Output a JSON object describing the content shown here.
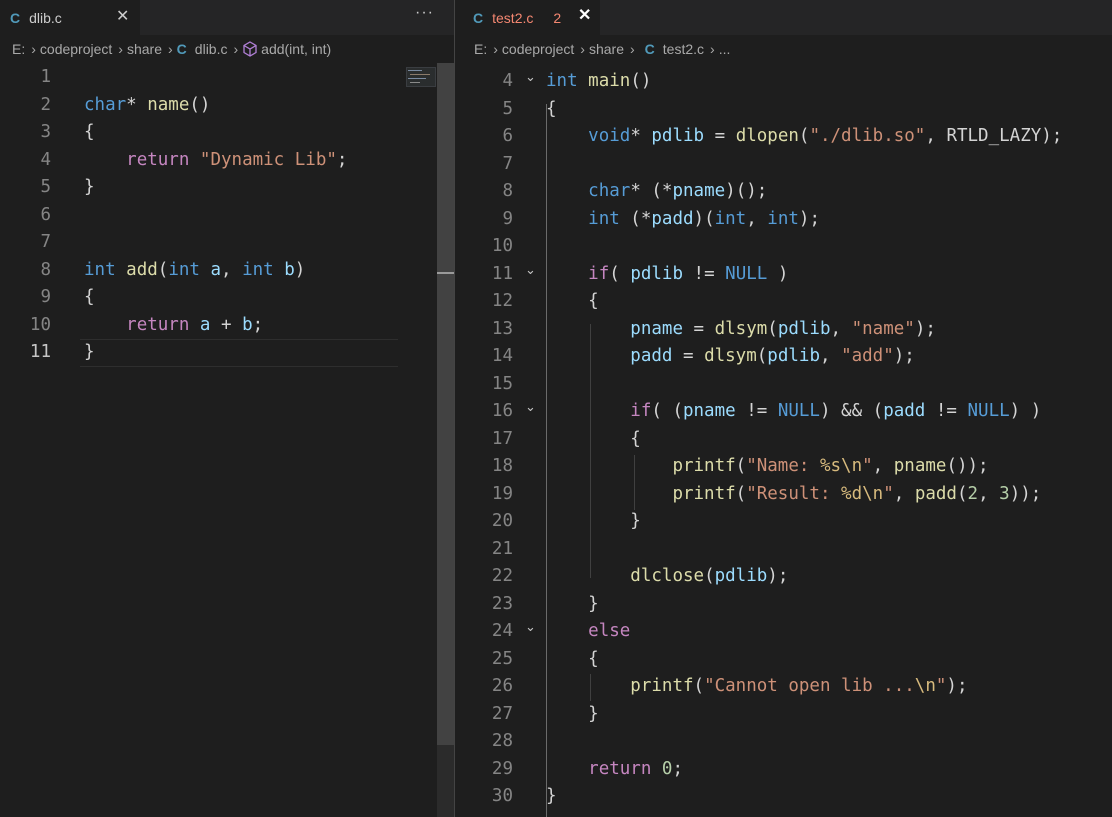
{
  "left": {
    "tab": {
      "lang": "C",
      "name": "dlib.c",
      "close": "✕"
    },
    "more": "···",
    "breadcrumb": [
      "E:",
      "codeproject",
      "share",
      "C",
      "dlib.c",
      "add(int, int)"
    ]
  },
  "right": {
    "tab": {
      "lang": "C",
      "name": "test2.c",
      "problems": "2",
      "close": "✕"
    },
    "breadcrumb": [
      "E:",
      "codeproject",
      "share",
      "C",
      "test2.c",
      "..."
    ]
  },
  "left_code": {
    "line_numbers": [
      "1",
      "2",
      "3",
      "4",
      "5",
      "6",
      "7",
      "8",
      "9",
      "10",
      "11"
    ],
    "lines": [
      [],
      [
        [
          "kw",
          "char"
        ],
        [
          "p",
          "* "
        ],
        [
          "fn",
          "name"
        ],
        [
          "p",
          "()"
        ]
      ],
      [
        [
          "p",
          "{"
        ]
      ],
      [
        [
          "p",
          "    "
        ],
        [
          "ctl",
          "return"
        ],
        [
          "p",
          " "
        ],
        [
          "str",
          "\"Dynamic Lib\""
        ],
        [
          "p",
          ";"
        ]
      ],
      [
        [
          "p",
          "}"
        ]
      ],
      [],
      [],
      [
        [
          "kw",
          "int"
        ],
        [
          "p",
          " "
        ],
        [
          "fn",
          "add"
        ],
        [
          "p",
          "("
        ],
        [
          "kw",
          "int"
        ],
        [
          "p",
          " "
        ],
        [
          "var",
          "a"
        ],
        [
          "p",
          ", "
        ],
        [
          "kw",
          "int"
        ],
        [
          "p",
          " "
        ],
        [
          "var",
          "b"
        ],
        [
          "p",
          ")"
        ]
      ],
      [
        [
          "p",
          "{"
        ]
      ],
      [
        [
          "p",
          "    "
        ],
        [
          "ctl",
          "return"
        ],
        [
          "p",
          " "
        ],
        [
          "var",
          "a"
        ],
        [
          "p",
          " + "
        ],
        [
          "var",
          "b"
        ],
        [
          "p",
          ";"
        ]
      ],
      [
        [
          "p",
          "}"
        ]
      ]
    ]
  },
  "right_code": {
    "line_numbers": [
      "4",
      "5",
      "6",
      "7",
      "8",
      "9",
      "10",
      "11",
      "12",
      "13",
      "14",
      "15",
      "16",
      "17",
      "18",
      "19",
      "20",
      "21",
      "22",
      "23",
      "24",
      "25",
      "26",
      "27",
      "28",
      "29",
      "30"
    ],
    "lines": [
      [
        [
          "kw",
          "int"
        ],
        [
          "p",
          " "
        ],
        [
          "fn",
          "main"
        ],
        [
          "p",
          "()"
        ]
      ],
      [
        [
          "p",
          "{"
        ]
      ],
      [
        [
          "p",
          "    "
        ],
        [
          "kw",
          "void"
        ],
        [
          "p",
          "* "
        ],
        [
          "var",
          "pdlib"
        ],
        [
          "p",
          " = "
        ],
        [
          "fn",
          "dlopen"
        ],
        [
          "p",
          "("
        ],
        [
          "str",
          "\"./dlib.so\""
        ],
        [
          "p",
          ", "
        ],
        [
          "p",
          "RTLD_LAZY"
        ],
        [
          "p",
          ");"
        ]
      ],
      [],
      [
        [
          "p",
          "    "
        ],
        [
          "kw",
          "char"
        ],
        [
          "p",
          "* (*"
        ],
        [
          "var",
          "pname"
        ],
        [
          "p",
          ")();"
        ]
      ],
      [
        [
          "p",
          "    "
        ],
        [
          "kw",
          "int"
        ],
        [
          "p",
          " (*"
        ],
        [
          "var",
          "padd"
        ],
        [
          "p",
          ")("
        ],
        [
          "kw",
          "int"
        ],
        [
          "p",
          ", "
        ],
        [
          "kw",
          "int"
        ],
        [
          "p",
          ");"
        ]
      ],
      [],
      [
        [
          "p",
          "    "
        ],
        [
          "ctl",
          "if"
        ],
        [
          "p",
          "( "
        ],
        [
          "var",
          "pdlib"
        ],
        [
          "p",
          " != "
        ],
        [
          "con",
          "NULL"
        ],
        [
          "p",
          " )"
        ]
      ],
      [
        [
          "p",
          "    {"
        ]
      ],
      [
        [
          "p",
          "        "
        ],
        [
          "var",
          "pname"
        ],
        [
          "p",
          " = "
        ],
        [
          "fn",
          "dlsym"
        ],
        [
          "p",
          "("
        ],
        [
          "var",
          "pdlib"
        ],
        [
          "p",
          ", "
        ],
        [
          "str",
          "\"name\""
        ],
        [
          "p",
          ");"
        ]
      ],
      [
        [
          "p",
          "        "
        ],
        [
          "var",
          "padd"
        ],
        [
          "p",
          " = "
        ],
        [
          "fn",
          "dlsym"
        ],
        [
          "p",
          "("
        ],
        [
          "var",
          "pdlib"
        ],
        [
          "p",
          ", "
        ],
        [
          "str",
          "\"add\""
        ],
        [
          "p",
          ");"
        ]
      ],
      [],
      [
        [
          "p",
          "        "
        ],
        [
          "ctl",
          "if"
        ],
        [
          "p",
          "( ("
        ],
        [
          "var",
          "pname"
        ],
        [
          "p",
          " != "
        ],
        [
          "con",
          "NULL"
        ],
        [
          "p",
          ") && ("
        ],
        [
          "var",
          "padd"
        ],
        [
          "p",
          " != "
        ],
        [
          "con",
          "NULL"
        ],
        [
          "p",
          ") )"
        ]
      ],
      [
        [
          "p",
          "        {"
        ]
      ],
      [
        [
          "p",
          "            "
        ],
        [
          "fn",
          "printf"
        ],
        [
          "p",
          "("
        ],
        [
          "str",
          "\"Name: "
        ],
        [
          "esc",
          "%s\\n"
        ],
        [
          "str",
          "\""
        ],
        [
          "p",
          ", "
        ],
        [
          "fn",
          "pname"
        ],
        [
          "p",
          "());"
        ]
      ],
      [
        [
          "p",
          "            "
        ],
        [
          "fn",
          "printf"
        ],
        [
          "p",
          "("
        ],
        [
          "str",
          "\"Result: "
        ],
        [
          "esc",
          "%d\\n"
        ],
        [
          "str",
          "\""
        ],
        [
          "p",
          ", "
        ],
        [
          "fn",
          "padd"
        ],
        [
          "p",
          "("
        ],
        [
          "num",
          "2"
        ],
        [
          "p",
          ", "
        ],
        [
          "num",
          "3"
        ],
        [
          "p",
          "));"
        ]
      ],
      [
        [
          "p",
          "        }"
        ]
      ],
      [],
      [
        [
          "p",
          "        "
        ],
        [
          "fn",
          "dlclose"
        ],
        [
          "p",
          "("
        ],
        [
          "var",
          "pdlib"
        ],
        [
          "p",
          ");"
        ]
      ],
      [
        [
          "p",
          "    }"
        ]
      ],
      [
        [
          "p",
          "    "
        ],
        [
          "ctl",
          "else"
        ]
      ],
      [
        [
          "p",
          "    {"
        ]
      ],
      [
        [
          "p",
          "        "
        ],
        [
          "fn",
          "printf"
        ],
        [
          "p",
          "("
        ],
        [
          "str",
          "\"Cannot open lib ..."
        ],
        [
          "esc",
          "\\n"
        ],
        [
          "str",
          "\""
        ],
        [
          "p",
          ");"
        ]
      ],
      [
        [
          "p",
          "    }"
        ]
      ],
      [],
      [
        [
          "p",
          "    "
        ],
        [
          "ctl",
          "return"
        ],
        [
          "p",
          " "
        ],
        [
          "num",
          "0"
        ],
        [
          "p",
          ";"
        ]
      ],
      [
        [
          "p",
          "}"
        ]
      ]
    ]
  },
  "colors": {
    "bg": "#1e1e1e",
    "keyword": "#569cd6",
    "control": "#c586c0",
    "function": "#dcdcaa",
    "string": "#ce9178",
    "variable": "#9cdcfe",
    "number": "#b5cea8",
    "escape": "#d7ba7d"
  }
}
